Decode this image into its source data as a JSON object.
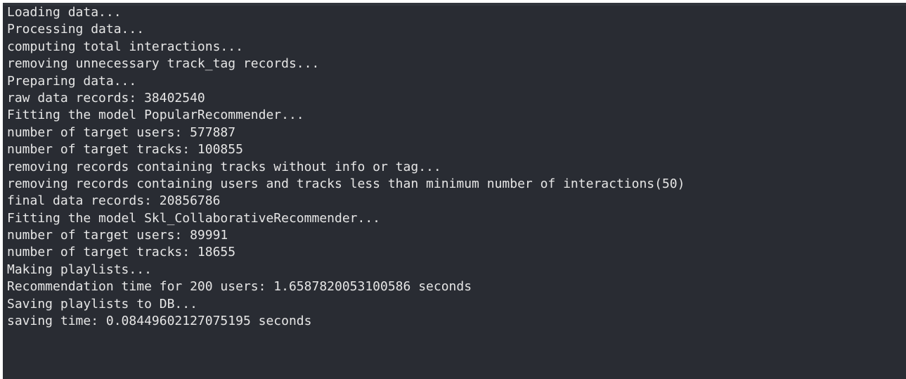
{
  "terminal": {
    "lines": [
      "Loading data...",
      "Processing data...",
      "computing total interactions...",
      "removing unnecessary track_tag records...",
      "Preparing data...",
      "raw data records: 38402540",
      "Fitting the model PopularRecommender...",
      "number of target users: 577887",
      "number of target tracks: 100855",
      "removing records containing tracks without info or tag...",
      "removing records containing users and tracks less than minimum number of interactions(50)",
      "final data records: 20856786",
      "Fitting the model Skl_CollaborativeRecommender...",
      "number of target users: 89991",
      "number of target tracks: 18655",
      "Making playlists...",
      "Recommendation time for 200 users: 1.6587820053100586 seconds",
      "Saving playlists to DB...",
      "saving time: 0.08449602127075195 seconds"
    ],
    "colors": {
      "background": "#292c33",
      "text": "#e6e6e6"
    }
  }
}
